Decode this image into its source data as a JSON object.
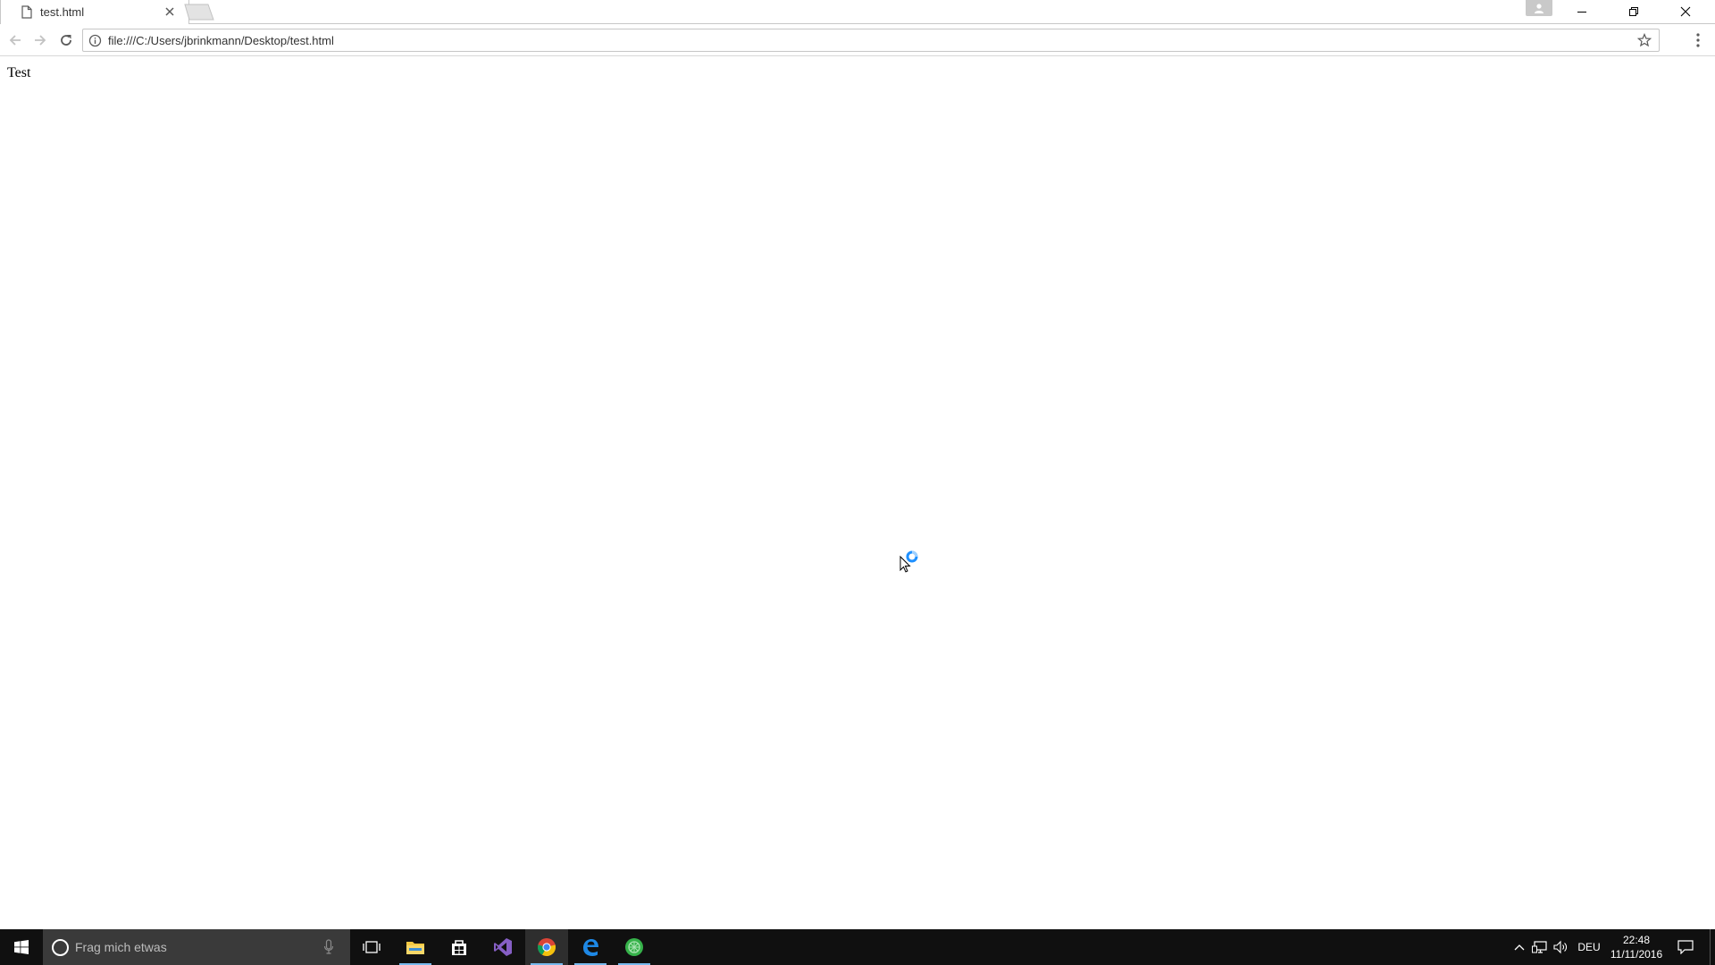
{
  "browser": {
    "tab": {
      "title": "test.html",
      "icon": "page-icon",
      "close_icon": "close-icon"
    },
    "new_tab_icon": "new-tab-icon",
    "window_controls": [
      "minimize-icon",
      "restore-icon",
      "close-icon"
    ],
    "profile_icon": "person-icon",
    "toolbar": {
      "back_icon": "arrow-left-icon",
      "forward_icon": "arrow-right-icon",
      "reload_icon": "reload-icon",
      "address": "file:///C:/Users/jbrinkmann/Desktop/test.html",
      "info_icon": "info-icon",
      "bookmark_icon": "star-icon",
      "menu_icon": "vertical-dots-icon"
    }
  },
  "page": {
    "text": "Test",
    "cursor": "busy-arrow-cursor"
  },
  "taskbar": {
    "start_icon": "windows-logo-icon",
    "search": {
      "placeholder": "Frag mich etwas",
      "cortana_icon": "cortana-circle-icon",
      "mic_icon": "microphone-icon"
    },
    "task_view_icon": "task-view-icon",
    "apps": [
      {
        "name": "file-explorer-icon",
        "running": true
      },
      {
        "name": "store-icon",
        "running": false
      },
      {
        "name": "visual-studio-icon",
        "running": false
      },
      {
        "name": "chrome-icon",
        "running": true,
        "active": true
      },
      {
        "name": "edge-icon",
        "running": true
      },
      {
        "name": "green-app-icon",
        "running": true
      }
    ],
    "tray": {
      "chevron_icon": "chevron-up-icon",
      "network_icon": "network-icon",
      "volume_icon": "volume-icon",
      "language": "DEU",
      "time": "22:48",
      "date": "11/11/2016",
      "notifications_icon": "action-center-icon"
    }
  },
  "colors": {
    "taskbar_bg": "#101010",
    "search_bg": "#3a3a3a",
    "running_indicator": "#76b9ed",
    "spinner": "#1e90ff"
  }
}
